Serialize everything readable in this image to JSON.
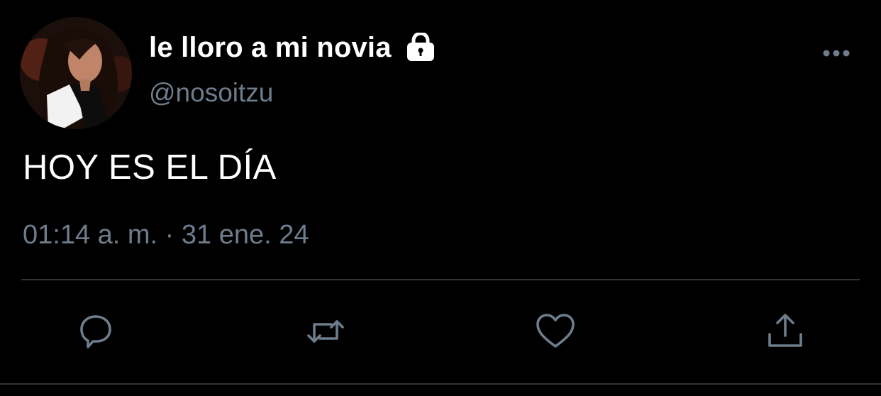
{
  "tweet": {
    "display_name": "le lloro a mi novia",
    "handle": "@nosoitzu",
    "text": "HOY ES EL DÍA",
    "timestamp": "01:14 a. m. · 31 ene. 24",
    "protected_icon": "lock-icon",
    "more_icon": "more-horizontal-icon",
    "avatar": "profile-photo"
  },
  "actions": [
    {
      "name": "reply",
      "icon": "reply-bubble-icon"
    },
    {
      "name": "retweet",
      "icon": "retweet-icon"
    },
    {
      "name": "like",
      "icon": "heart-icon"
    },
    {
      "name": "share",
      "icon": "share-icon"
    }
  ],
  "colors": {
    "background": "#000000",
    "primary_text": "#ffffff",
    "secondary_text": "#6e7d8c",
    "divider": "#2f3336",
    "icon": "#6e7d8c"
  }
}
